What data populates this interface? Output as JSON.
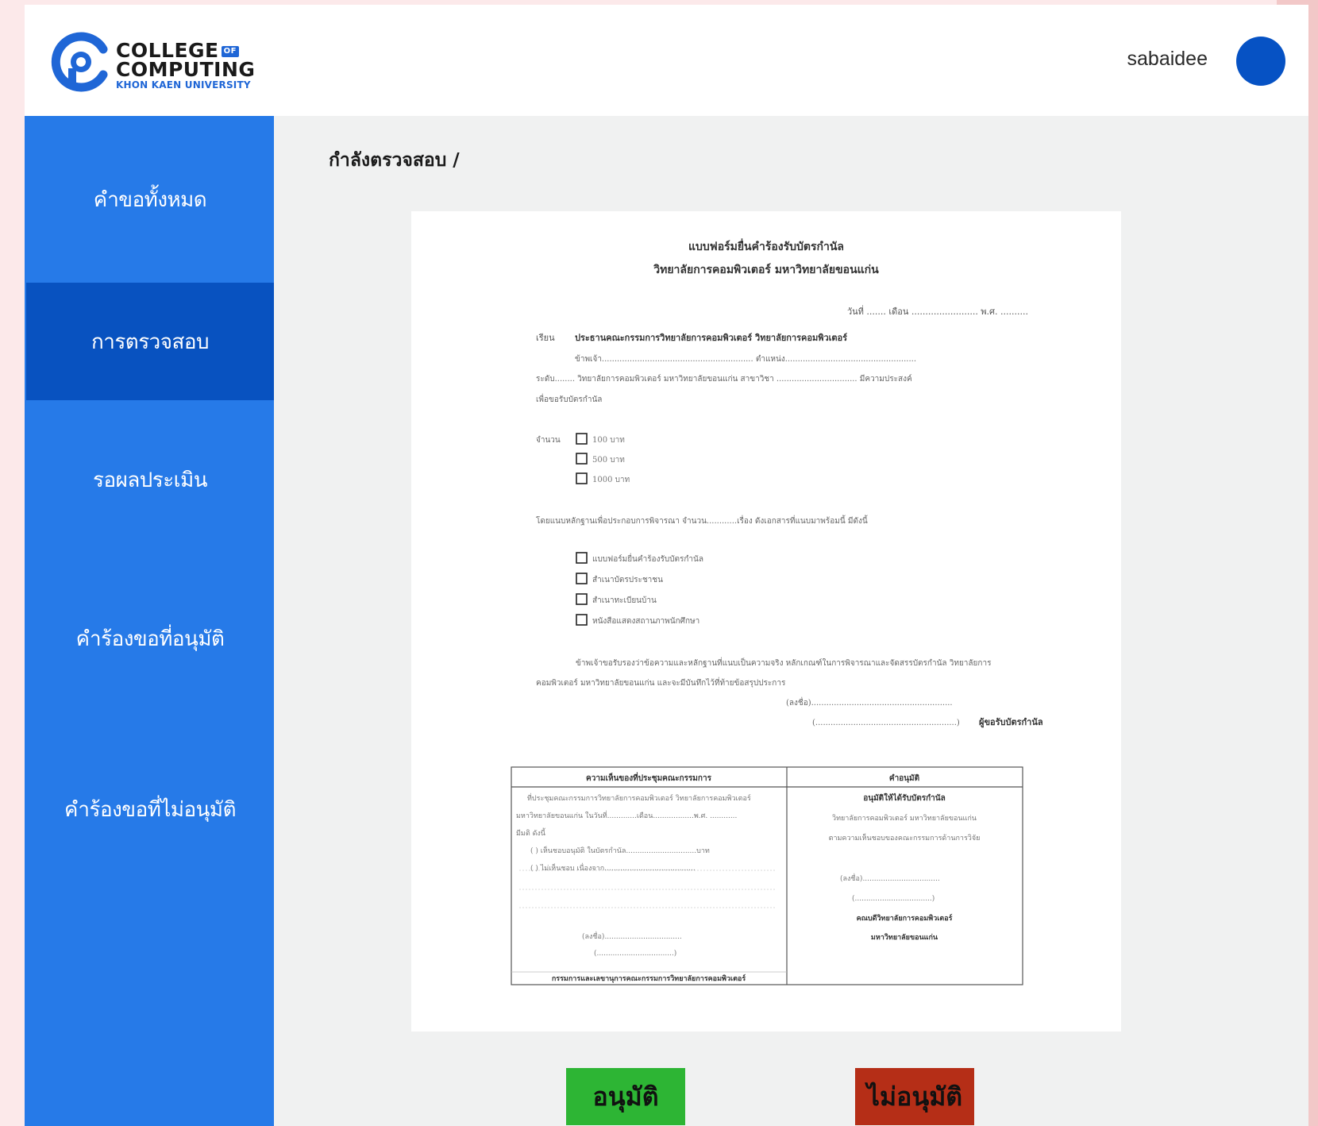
{
  "header": {
    "logo": {
      "line1": "COLLEGE",
      "badge": "OF",
      "line2": "COMPUTING",
      "line3": "KHON KAEN UNIVERSITY"
    },
    "username": "sabaidee"
  },
  "sidebar": {
    "items": [
      {
        "label": "คำขอทั้งหมด"
      },
      {
        "label": "การตรวจสอบ"
      },
      {
        "label": "รอผลประเมิน"
      },
      {
        "label": "คำร้องขอที่อนุมัติ"
      },
      {
        "label": "คำร้องขอที่ไม่อนุมัติ"
      }
    ]
  },
  "main": {
    "title": "กำลังตรวจสอบ /"
  },
  "document": {
    "title_line1": "แบบฟอร์มยื่นคำร้องรับบัตรกำนัล",
    "title_line2": "วิทยาลัยการคอมพิวเตอร์ มหาวิทยาลัยขอนแก่น",
    "date_line": "วันที่ ....... เดือน ........................ พ.ศ. ..........",
    "to_label": "เรียน",
    "to_value": "ประธานคณะกรรมการวิทยาลัยการคอมพิวเตอร์ วิทยาลัยการคอมพิวเตอร์",
    "line_a": "ข้าพเจ้า............................................................ ตำแหน่ง....................................................",
    "line_b": "ระดับ........ วิทยาลัยการคอมพิวเตอร์ มหาวิทยาลัยขอนแก่น สาขาวิชา ................................ มีความประสงค์",
    "line_c": "เพื่อขอรับบัตรกำนัล",
    "amount_label": "จำนวน",
    "amounts": [
      "100 บาท",
      "500 บาท",
      "1000 บาท"
    ],
    "evidence_line": "โดยแนบหลักฐานเพื่อประกอบการพิจารณา จำนวน............เรื่อง ดังเอกสารที่แนบมาพร้อมนี้ มีดังนี้",
    "attachments": [
      "แบบฟอร์มยื่นคำร้องรับบัตรกำนัล",
      "สำเนาบัตรประชาชน",
      "สำเนาทะเบียนบ้าน",
      "หนังสือแสดงสถานภาพนักศึกษา"
    ],
    "certify_line1": "ข้าพเจ้าขอรับรองว่าข้อความและหลักฐานที่แนบเป็นความจริง หลักเกณฑ์ในการพิจารณาและจัดสรรบัตรกำนัล วิทยาลัยการ",
    "certify_line2": "คอมพิวเตอร์ มหาวิทยาลัยขอนแก่น และจะมีบันทึกไว้ที่ท้ายข้อสรุปประการ",
    "sign_line": "(ลงชื่อ)........................................................",
    "sign_name": "(........................................................)",
    "sign_role": "ผู้ขอรับบัตรกำนัล",
    "table": {
      "left_header": "ความเห็นของที่ประชุมคณะกรรมการ",
      "left_lines": [
        "ที่ประชุมคณะกรรมการวิทยาลัยการคอมพิวเตอร์ วิทยาลัยการคอมพิวเตอร์",
        "มหาวิทยาลัยขอนแก่น ในวันที่.............เดือน..................พ.ศ. ............",
        "มีมติ ดังนี้",
        "(  )     เห็นชอบอนุมัติ ในบัตรกำนัล...............................บาท",
        "(  )     ไม่เห็นชอบ เนื่องจาก........................................"
      ],
      "left_sign": "(ลงชื่อ)..................................",
      "left_sign_name": "(..................................)",
      "left_role": "กรรมการและเลขานุการคณะกรรมการวิทยาลัยการคอมพิวเตอร์",
      "right_header": "คำอนุมัติ",
      "right_bold": "อนุมัติให้ได้รับบัตรกำนัล",
      "right_lines": [
        "วิทยาลัยการคอมพิวเตอร์ มหาวิทยาลัยขอนแก่น",
        "ตามความเห็นชอบของคณะกรรมการด้านการวิจัย"
      ],
      "right_sign": "(ลงชื่อ)..................................",
      "right_sign_name": "(..................................)",
      "right_role1": "คณบดีวิทยาลัยการคอมพิวเตอร์",
      "right_role2": "มหาวิทยาลัยขอนแก่น"
    }
  },
  "actions": {
    "approve_label": "อนุมัติ",
    "reject_label": "ไม่อนุมัติ"
  },
  "colors": {
    "sidebar": "#267ae8",
    "sidebar_active": "#0852c0",
    "approve": "#2db534",
    "reject": "#b52e17",
    "avatar": "#0652c4"
  }
}
